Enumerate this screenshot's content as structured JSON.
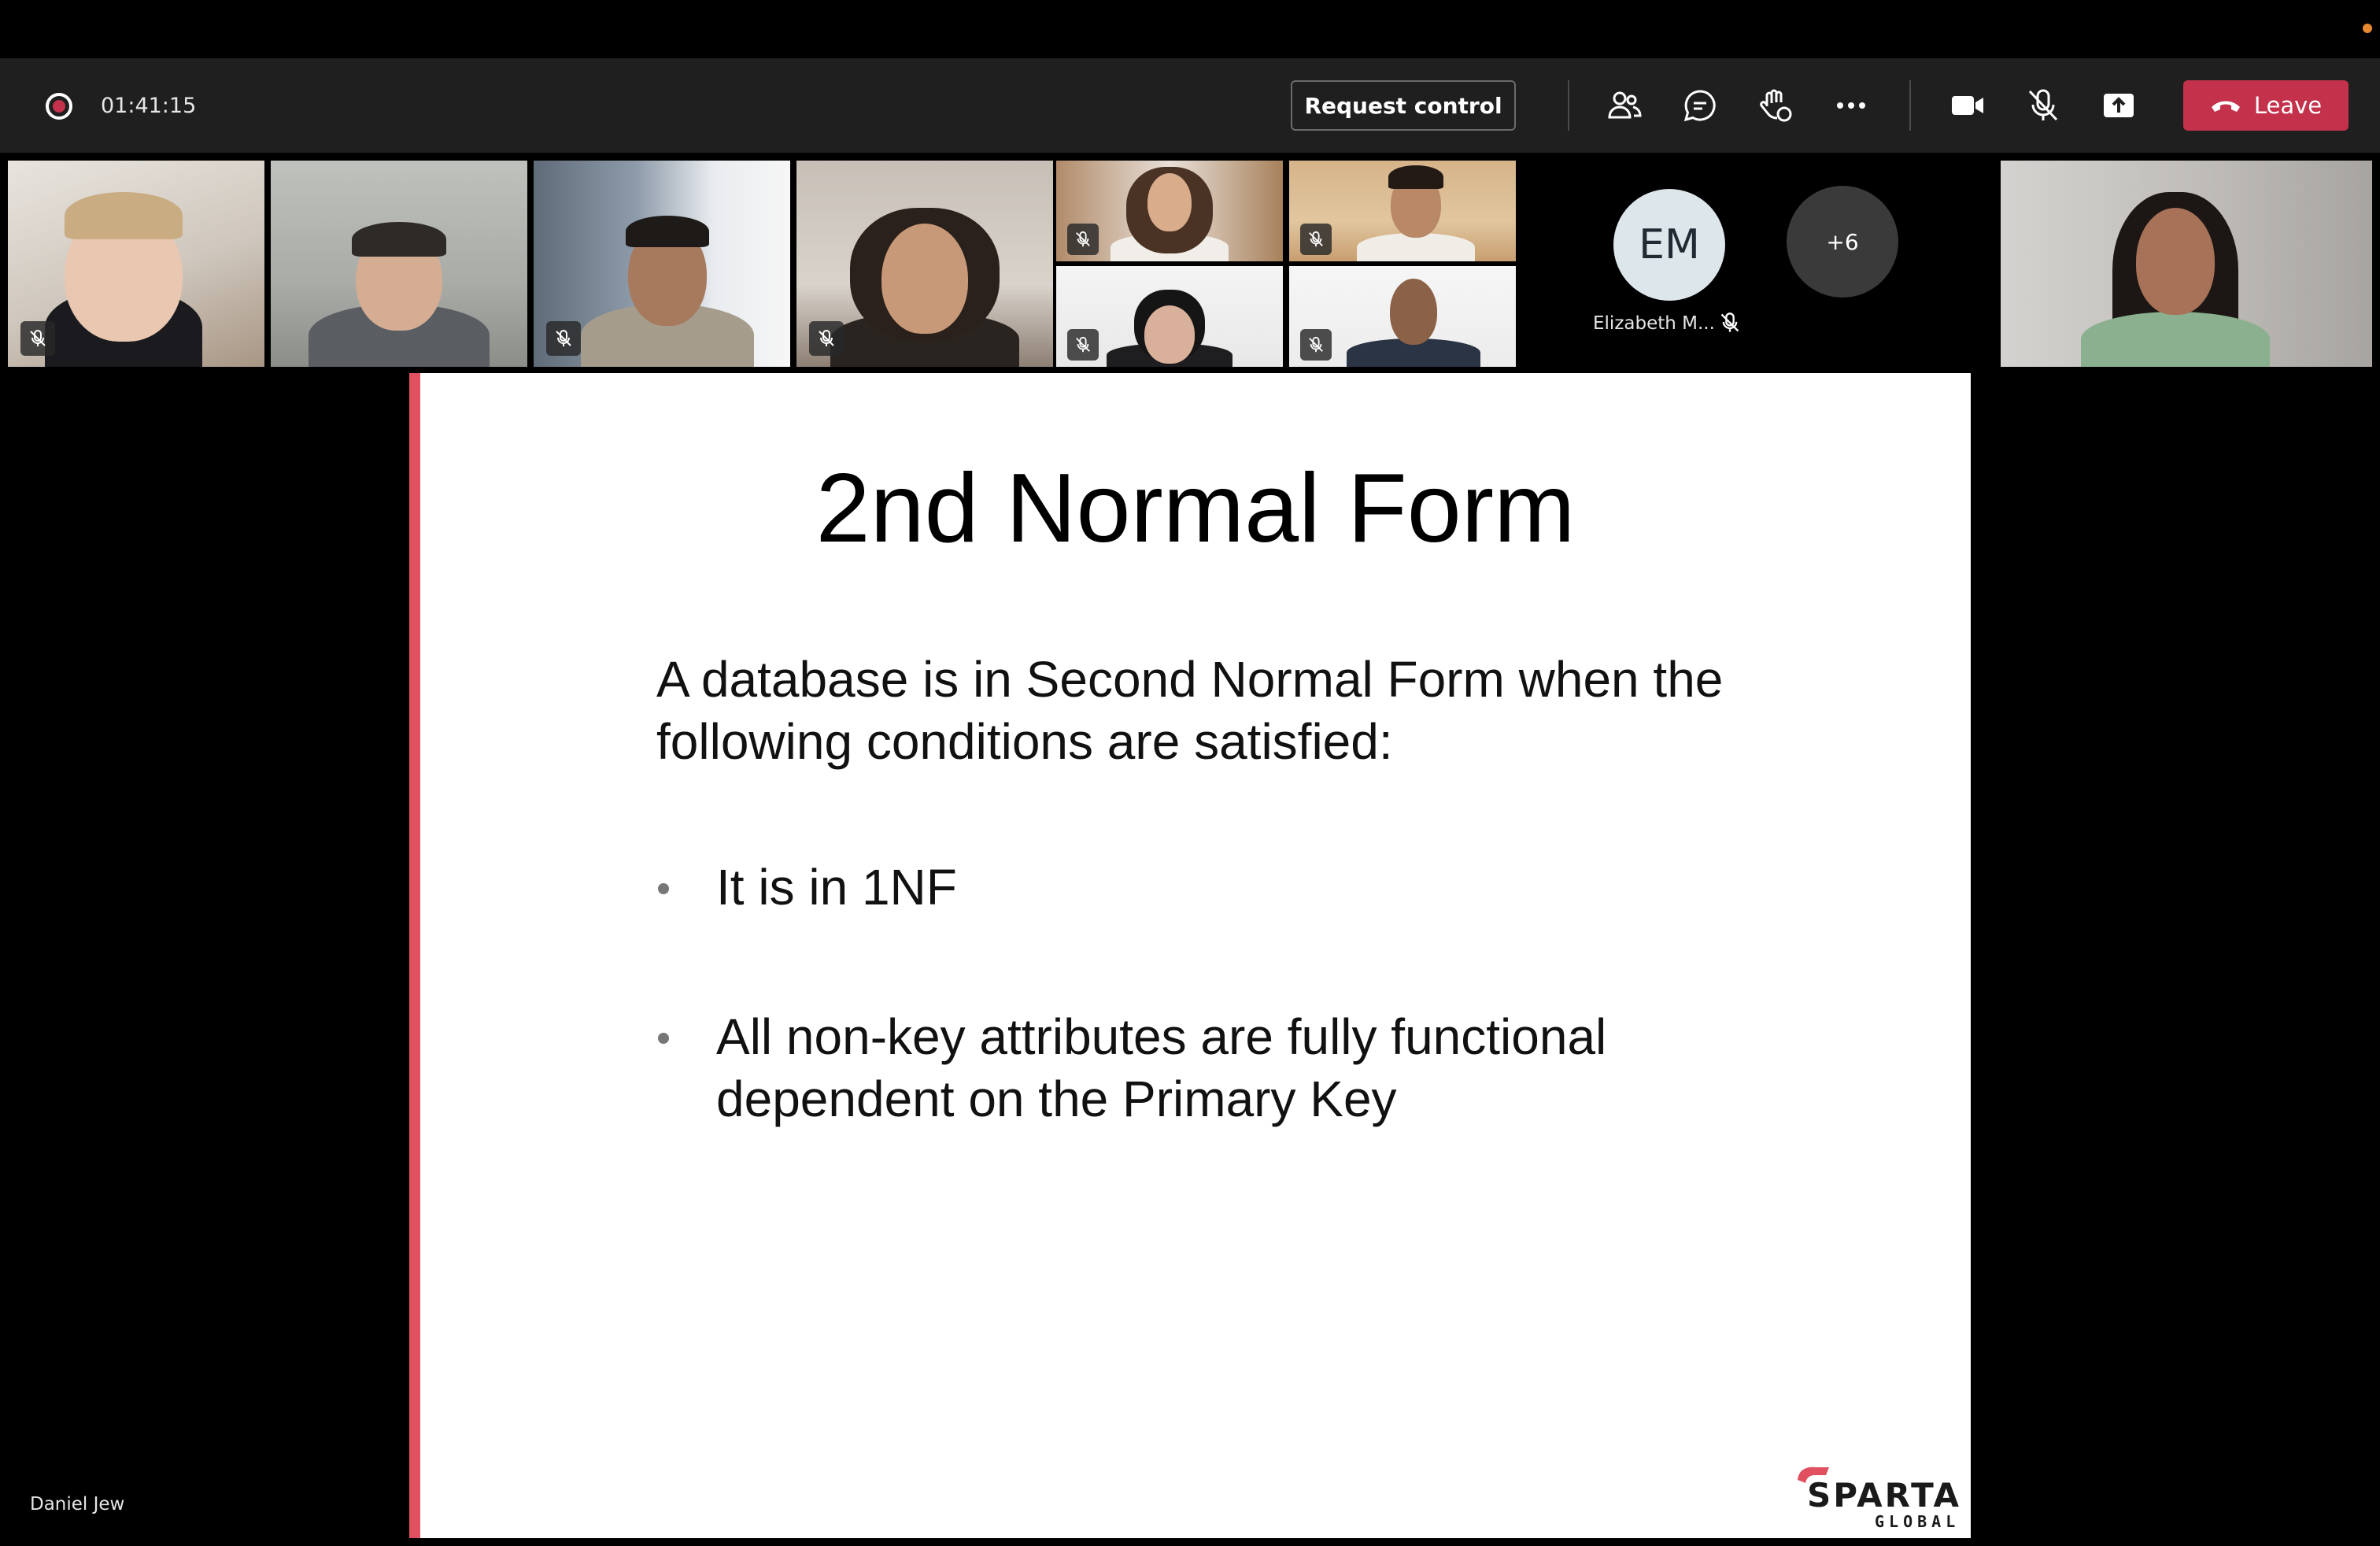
{
  "toolbar": {
    "recording_icon": "recording-icon",
    "timer": "01:41:15",
    "request_control_label": "Request control",
    "icons": [
      "people-icon",
      "chat-icon",
      "raise-hand-icon",
      "more-options-icon",
      "camera-icon",
      "mic-off-icon",
      "share-screen-icon"
    ],
    "leave_label": "Leave",
    "leave_color": "#c4314b"
  },
  "participants": {
    "tiles": [
      {
        "name": "",
        "muted": true
      },
      {
        "name": "",
        "muted": false,
        "selected": true
      },
      {
        "name": "",
        "muted": true
      },
      {
        "name": "",
        "muted": true
      },
      {
        "name": "",
        "muted": true
      },
      {
        "name": "",
        "muted": true
      },
      {
        "name": "",
        "muted": true
      },
      {
        "name": "",
        "muted": true
      }
    ],
    "em_initials": "EM",
    "em_name": "Elizabeth M...",
    "overflow_count": "+6"
  },
  "slide": {
    "title": "2nd Normal Form",
    "intro_line1": "A database is in Second Normal Form when the",
    "intro_line2": "following conditions are satisfied:",
    "bullets": [
      {
        "line1": "It is in 1NF",
        "line2": ""
      },
      {
        "line1": "All non-key attributes are fully functional",
        "line2": "dependent on the Primary Key"
      }
    ],
    "logo_text": "SPARTA",
    "logo_subtext": "GLOBAL",
    "accent_color": "#e0505e"
  },
  "presenter_name": "Daniel Jew"
}
